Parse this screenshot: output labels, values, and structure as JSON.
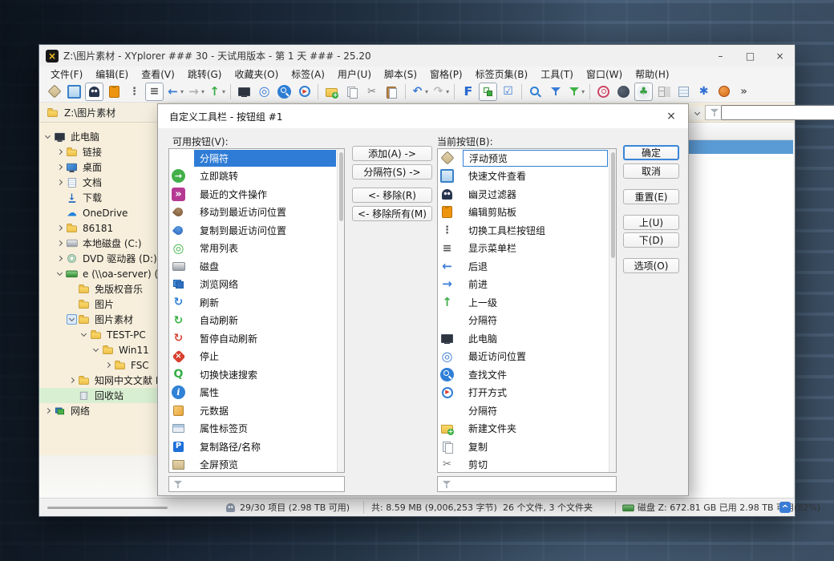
{
  "window": {
    "title": "Z:\\图片素材 - XYplorer ### 30 - 天试用版本 - 第 1 天 ### - 25.20",
    "controls": {
      "minimize": "–",
      "maximize": "□",
      "close": "×"
    }
  },
  "menu_bar": {
    "items": [
      "文件(F)",
      "编辑(E)",
      "查看(V)",
      "跳转(G)",
      "收藏夹(O)",
      "标签(A)",
      "用户(U)",
      "脚本(S)",
      "窗格(P)",
      "标签页集(B)",
      "工具(T)",
      "窗口(W)",
      "帮助(H)"
    ]
  },
  "toolbar": {
    "buttons": [
      {
        "name": "floating-preview",
        "icon": "float-preview"
      },
      {
        "name": "quick-file-view",
        "icon": "quick-view"
      },
      {
        "name": "ghost-filter",
        "icon": "ghost",
        "pressed": true
      },
      {
        "name": "edit-clipboard",
        "icon": "clipboard"
      },
      {
        "name": "toggle-toolbar-group",
        "icon": "vdots"
      },
      {
        "name": "show-menu-bar",
        "icon": "hlines",
        "pressed": true
      },
      {
        "name": "back",
        "icon": "back",
        "dropdown": true
      },
      {
        "name": "forward",
        "icon": "forward-gray",
        "dropdown": true
      },
      {
        "name": "up",
        "icon": "up",
        "dropdown": true
      },
      {
        "sep": true
      },
      {
        "name": "this-pc",
        "icon": "this-pc"
      },
      {
        "name": "recent-locations",
        "icon": "dartboard"
      },
      {
        "name": "find-files",
        "icon": "find-file"
      },
      {
        "name": "open-with",
        "icon": "open-with"
      },
      {
        "sep": true
      },
      {
        "name": "new-folder",
        "icon": "new-folder"
      },
      {
        "name": "copy",
        "icon": "copy"
      },
      {
        "name": "cut",
        "icon": "cut"
      },
      {
        "name": "paste",
        "icon": "paste"
      },
      {
        "sep": true
      },
      {
        "name": "undo",
        "icon": "undo",
        "dropdown": true
      },
      {
        "name": "redo",
        "icon": "redo",
        "dropdown": true
      },
      {
        "sep": true
      },
      {
        "name": "favorites",
        "icon": "letter-f"
      },
      {
        "name": "tree-toggle",
        "icon": "tree-toggle",
        "pressed": true
      },
      {
        "name": "checkbox-mode",
        "icon": "checkbox"
      },
      {
        "sep": true
      },
      {
        "name": "quick-search",
        "icon": "search-mag"
      },
      {
        "name": "filter",
        "icon": "funnel-blue"
      },
      {
        "name": "visual-filter",
        "icon": "funnel-green",
        "dropdown": true
      },
      {
        "sep": true
      },
      {
        "name": "spiral-tool",
        "icon": "spiral"
      },
      {
        "name": "dark-mode",
        "icon": "moon"
      },
      {
        "name": "tree-path-tracing",
        "icon": "tree-cloud",
        "pressed": true
      },
      {
        "name": "tile-view",
        "icon": "four-squares"
      },
      {
        "name": "report-view",
        "icon": "report"
      },
      {
        "name": "gear-badge",
        "icon": "gear-badge"
      },
      {
        "name": "basketball",
        "icon": "basketball"
      },
      {
        "name": "toolbar-overflow",
        "icon": "overflow-chevrons"
      }
    ]
  },
  "tab_bar": {
    "active_tab": "Z:\\图片素材"
  },
  "tree": {
    "items": [
      {
        "label": "此电脑",
        "level": 0,
        "icon": "this-pc",
        "exp": "expanded"
      },
      {
        "label": "链接",
        "level": 1,
        "icon": "folder",
        "exp": "collapsed"
      },
      {
        "label": "桌面",
        "level": 1,
        "icon": "desktop",
        "exp": "collapsed"
      },
      {
        "label": "文档",
        "level": 1,
        "icon": "document",
        "exp": "collapsed"
      },
      {
        "label": "下载",
        "level": 1,
        "icon": "download",
        "exp": "none"
      },
      {
        "label": "OneDrive",
        "level": 1,
        "icon": "onedrive",
        "exp": "none"
      },
      {
        "label": "86181",
        "level": 1,
        "icon": "folder",
        "exp": "collapsed"
      },
      {
        "label": "本地磁盘 (C:)",
        "level": 1,
        "icon": "disk",
        "exp": "collapsed"
      },
      {
        "label": "DVD 驱动器 (D:) CCCOM",
        "level": 1,
        "icon": "dvd",
        "exp": "collapsed"
      },
      {
        "label": "e (\\\\oa-server) (Z:)",
        "level": 1,
        "icon": "netdrive",
        "exp": "expanded"
      },
      {
        "label": "免版权音乐",
        "level": 2,
        "icon": "folder",
        "exp": "none"
      },
      {
        "label": "图片",
        "level": 2,
        "icon": "folder",
        "exp": "none"
      },
      {
        "label": "图片素材",
        "level": 2,
        "icon": "folder",
        "exp": "expanded",
        "boxed": true
      },
      {
        "label": "TEST-PC",
        "level": 3,
        "icon": "folder",
        "exp": "expanded"
      },
      {
        "label": "Win11",
        "level": 4,
        "icon": "folder",
        "exp": "expanded"
      },
      {
        "label": "FSC",
        "level": 5,
        "icon": "folder",
        "exp": "collapsed"
      },
      {
        "label": "知网中文文献 PDF",
        "level": 2,
        "icon": "folder",
        "exp": "collapsed"
      },
      {
        "label": "回收站",
        "level": 2,
        "icon": "recycle",
        "exp": "none",
        "highlight": true
      },
      {
        "label": "网络",
        "level": 0,
        "icon": "network-pcs",
        "exp": "collapsed"
      }
    ]
  },
  "dialog": {
    "title": "自定义工具栏 - 按钮组 #1",
    "close_glyph": "×",
    "available_label": "可用按钮(V):",
    "current_label": "当前按钮(B):",
    "available": [
      {
        "label": "分隔符",
        "icon": "none",
        "selected": true
      },
      {
        "label": "立即跳转",
        "icon": "jump"
      },
      {
        "label": "最近的文件操作",
        "icon": "recent-ops"
      },
      {
        "label": "移动到最近访问位置",
        "icon": "acorn-brown"
      },
      {
        "label": "复制到最近访问位置",
        "icon": "acorn-blue"
      },
      {
        "label": "常用列表",
        "icon": "fav-list"
      },
      {
        "label": "磁盘",
        "icon": "disk"
      },
      {
        "label": "浏览网络",
        "icon": "browse-network"
      },
      {
        "label": "刷新",
        "icon": "refresh"
      },
      {
        "label": "自动刷新",
        "icon": "auto-refresh"
      },
      {
        "label": "暂停自动刷新",
        "icon": "pause-refresh"
      },
      {
        "label": "停止",
        "icon": "stop"
      },
      {
        "label": "切换快速搜索",
        "icon": "quick-search"
      },
      {
        "label": "属性",
        "icon": "properties"
      },
      {
        "label": "元数据",
        "icon": "metadata"
      },
      {
        "label": "属性标签页",
        "icon": "prop-tabs"
      },
      {
        "label": "复制路径/名称",
        "icon": "copy-path"
      },
      {
        "label": "全屏预览",
        "icon": "fullscreen-preview"
      }
    ],
    "current": [
      {
        "label": "浮动预览",
        "icon": "float-preview",
        "focused": true
      },
      {
        "label": "快速文件查看",
        "icon": "quick-view"
      },
      {
        "label": "幽灵过滤器",
        "icon": "ghost"
      },
      {
        "label": "编辑剪贴板",
        "icon": "clipboard"
      },
      {
        "label": "切换工具栏按钮组",
        "icon": "vdots"
      },
      {
        "label": "显示菜单栏",
        "icon": "hlines"
      },
      {
        "label": "后退",
        "icon": "back"
      },
      {
        "label": "前进",
        "icon": "forward"
      },
      {
        "label": "上一级",
        "icon": "up"
      },
      {
        "label": "分隔符",
        "icon": "none"
      },
      {
        "label": "此电脑",
        "icon": "this-pc"
      },
      {
        "label": "最近访问位置",
        "icon": "dartboard"
      },
      {
        "label": "查找文件",
        "icon": "find-file"
      },
      {
        "label": "打开方式",
        "icon": "open-with"
      },
      {
        "label": "分隔符",
        "icon": "none"
      },
      {
        "label": "新建文件夹",
        "icon": "new-folder"
      },
      {
        "label": "复制",
        "icon": "copy"
      },
      {
        "label": "剪切",
        "icon": "cut"
      }
    ],
    "transfer_buttons": [
      {
        "label": "添加(A) ->"
      },
      {
        "label": "分隔符(S) ->"
      },
      {
        "label": "<- 移除(R)"
      },
      {
        "label": "<- 移除所有(M)"
      }
    ],
    "action_buttons": [
      {
        "label": "确定",
        "focused": true
      },
      {
        "label": "取消"
      },
      {
        "label": "重置(E)"
      },
      {
        "label": "上(U)"
      },
      {
        "label": "下(D)"
      },
      {
        "label": "选项(O)"
      }
    ]
  },
  "status_bar": {
    "item_count": "29/30 项目 (2.98 TB 可用)",
    "total_size": "共: 8.59 MB (9,006,253 字节)",
    "file_count": "26 个文件, 3 个文件夹",
    "disk_info": "磁盘 Z: 672.81 GB 已用  2.98 TB 可用(82%)"
  }
}
